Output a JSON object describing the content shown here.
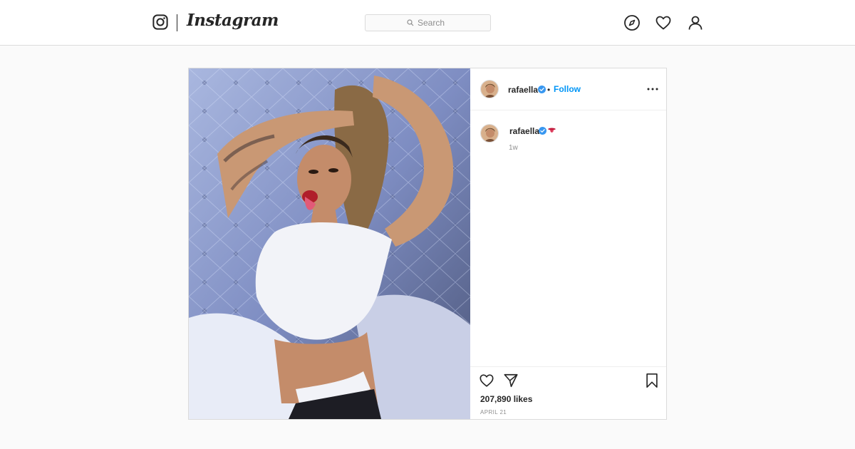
{
  "nav": {
    "logo_icon": "instagram-camera-icon",
    "wordmark": "Instagram",
    "search_placeholder": "Search",
    "icons": [
      "compass-icon",
      "heart-icon",
      "profile-icon"
    ]
  },
  "post": {
    "author": {
      "username": "rafaella",
      "verified": true,
      "follow_label": "Follow",
      "separator": "•"
    },
    "more_icon": "more-options-icon",
    "caption": {
      "username": "rafaella",
      "emoji": "tongue-emoji",
      "time": "1w"
    },
    "actions": {
      "like_icon": "heart-icon",
      "share_icon": "direct-share-icon",
      "save_icon": "bookmark-icon"
    },
    "likes": "207,890 likes",
    "date": "APRIL 21"
  },
  "colors": {
    "link_blue": "#0095f6",
    "verified_blue": "#3897f0",
    "border": "#dbdbdb",
    "background": "#fafafa"
  }
}
